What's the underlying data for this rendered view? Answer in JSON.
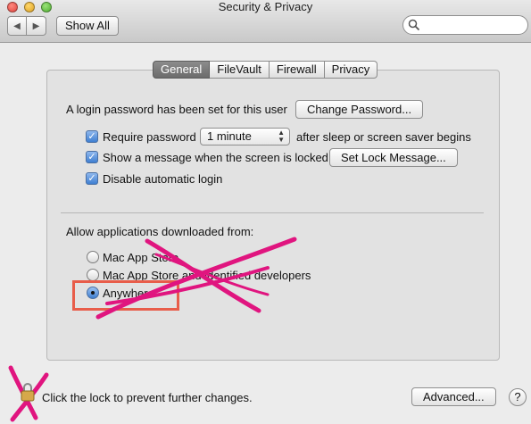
{
  "window": {
    "title": "Security & Privacy"
  },
  "toolbar": {
    "show_all_label": "Show All",
    "back_icon": "chevron-left-icon",
    "forward_icon": "chevron-right-icon",
    "search_icon": "search-icon"
  },
  "tabs": [
    {
      "label": "General",
      "active": true
    },
    {
      "label": "FileVault",
      "active": false
    },
    {
      "label": "Firewall",
      "active": false
    },
    {
      "label": "Privacy",
      "active": false
    }
  ],
  "general": {
    "login_password_text": "A login password has been set for this user",
    "change_password_label": "Change Password...",
    "require_password": {
      "label": "Require password",
      "checked": true
    },
    "require_password_select": {
      "value": "1 minute"
    },
    "require_password_suffix": "after sleep or screen saver begins",
    "show_message": {
      "label": "Show a message when the screen is locked",
      "checked": true
    },
    "set_lock_message_label": "Set Lock Message...",
    "disable_auto_login": {
      "label": "Disable automatic login",
      "checked": true
    }
  },
  "allow_apps": {
    "heading": "Allow applications downloaded from:",
    "options": [
      {
        "label": "Mac App Store",
        "selected": false
      },
      {
        "label": "Mac App Store and identified developers",
        "selected": false
      },
      {
        "label": "Anywhere",
        "selected": true
      }
    ]
  },
  "footer": {
    "lock_text": "Click the lock to prevent further changes.",
    "advanced_label": "Advanced...",
    "help_label": "?"
  },
  "annotations": {
    "highlight_color": "#e85d4a",
    "scribble_color": "#e0157f"
  }
}
